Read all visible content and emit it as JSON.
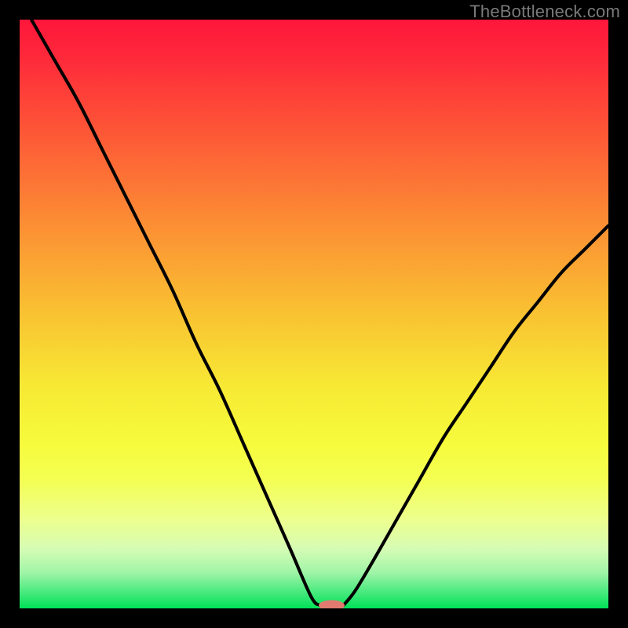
{
  "watermark": "TheBottleneck.com",
  "chart_data": {
    "type": "line",
    "title": "",
    "xlabel": "",
    "ylabel": "",
    "xlim": [
      0,
      100
    ],
    "ylim": [
      0,
      100
    ],
    "background_gradient_top": "#fe163b",
    "background_gradient_bottom": "#00e157",
    "series": [
      {
        "name": "curve-left",
        "x": [
          2,
          6,
          10,
          14,
          18,
          22,
          26,
          30,
          34,
          38,
          42,
          46,
          49.5,
          51
        ],
        "y": [
          100,
          93,
          86,
          78,
          70,
          62,
          54,
          45,
          37,
          28,
          19,
          10,
          2,
          0.5
        ]
      },
      {
        "name": "curve-right",
        "x": [
          55,
          57,
          60,
          64,
          68,
          72,
          76,
          80,
          84,
          88,
          92,
          96,
          100
        ],
        "y": [
          0.5,
          3,
          8,
          15,
          22,
          29,
          35,
          41,
          47,
          52,
          57,
          61,
          65
        ]
      }
    ],
    "minimum_marker": {
      "x": 53,
      "y": 0.5,
      "rx": 2.2,
      "ry": 0.9,
      "color": "#e27a6f"
    }
  }
}
